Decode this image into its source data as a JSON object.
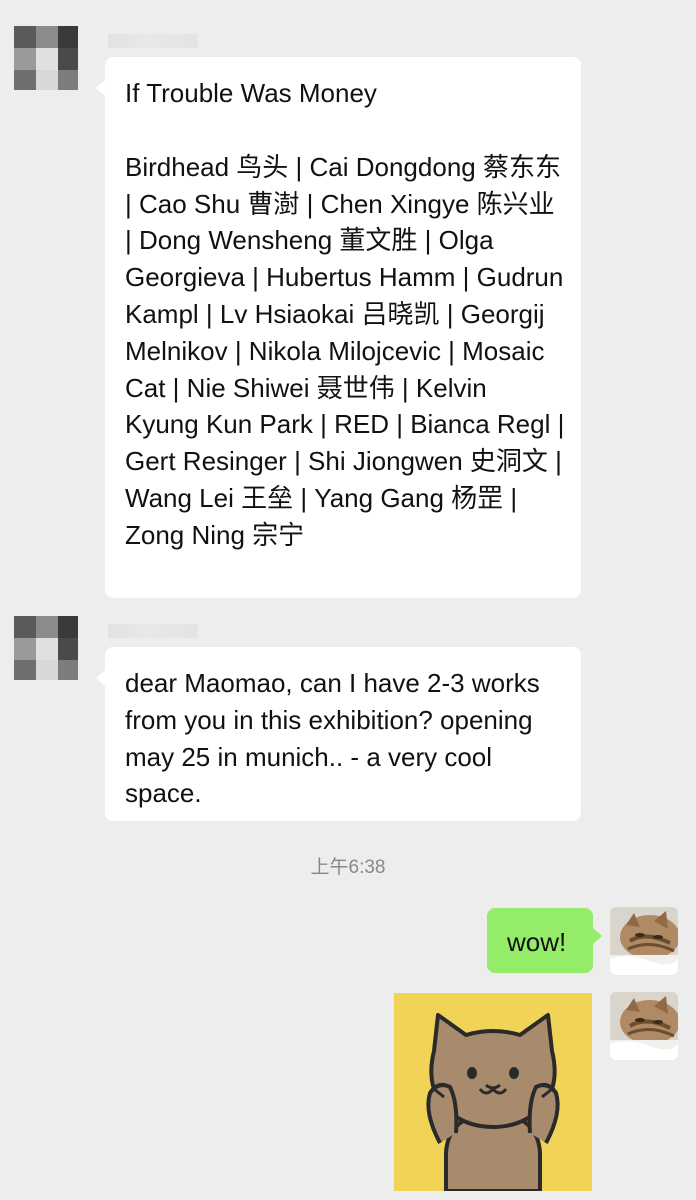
{
  "chat": {
    "messages": [
      {
        "title": "If Trouble Was Money",
        "body": "Birdhead 鸟头 | Cai Dongdong 蔡东东 | Cao Shu 曹澍 | Chen Xingye 陈兴业 | Dong Wensheng 董文胜 | Olga Georgieva | Hubertus Hamm | Gudrun Kampl | Lv Hsiaokai 吕晓凯 | Georgij Melnikov | Nikola Milojcevic | Mosaic Cat | Nie Shiwei 聂世伟 | Kelvin Kyung Kun Park | RED | Bianca Regl | Gert Resinger | Shi Jiongwen 史洞文 | Wang Lei 王垒 | Yang Gang 杨罡 | Zong Ning 宗宁"
      },
      {
        "body": "dear Maomao, can I have 2-3 works from you in this exhibition? opening may 25 in munich.. - a very cool space."
      },
      {
        "body": "wow!"
      }
    ],
    "timestamp": "上午6:38"
  },
  "colors": {
    "background": "#ededed",
    "bubble_in": "#ffffff",
    "bubble_out": "#95ec69",
    "sticker_bg": "#f1d457"
  },
  "icons": {
    "sender_avatar": "pixelated-avatar",
    "self_avatar": "cat-photo-avatar",
    "sticker": "cat-cheeks-sticker"
  }
}
